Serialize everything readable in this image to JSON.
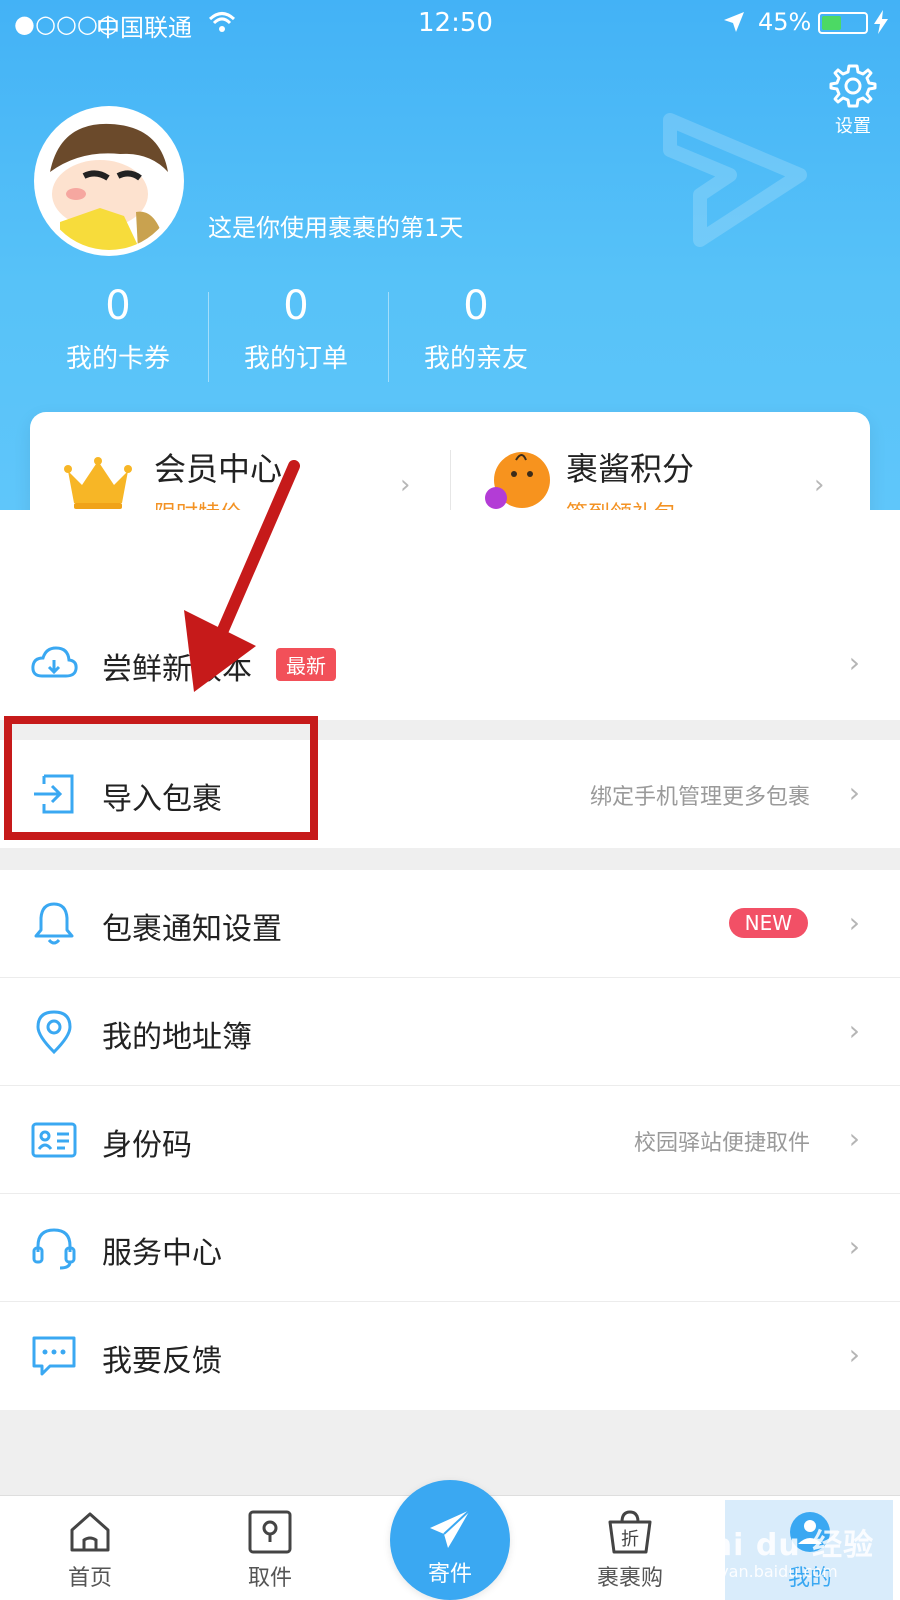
{
  "status_bar": {
    "signal": "●○○○○",
    "carrier": "中国联通",
    "time": "12:50",
    "battery_percent": "45%",
    "battery_level": 0.45
  },
  "header": {
    "settings_label": "设置",
    "welcome_text": "这是你使用裹裹的第1天",
    "stats": [
      {
        "value": "0",
        "label": "我的卡券"
      },
      {
        "value": "0",
        "label": "我的订单"
      },
      {
        "value": "0",
        "label": "我的亲友"
      }
    ]
  },
  "member_card": {
    "left": {
      "title": "会员中心",
      "subtitle": "限时特价",
      "icon": "crown-icon"
    },
    "right": {
      "title": "裹酱积分",
      "subtitle": "签到领礼包",
      "icon": "mascot-icon"
    }
  },
  "menu": {
    "beta": {
      "label": "尝鲜新版本",
      "badge": "最新",
      "icon": "cloud-download-icon"
    },
    "import": {
      "label": "导入包裹",
      "hint": "绑定手机管理更多包裹",
      "icon": "import-icon"
    },
    "notify": {
      "label": "包裹通知设置",
      "badge": "NEW",
      "icon": "bell-icon"
    },
    "address": {
      "label": "我的地址簿",
      "icon": "location-pin-icon"
    },
    "idcode": {
      "label": "身份码",
      "hint": "校园驿站便捷取件",
      "icon": "id-card-icon"
    },
    "service": {
      "label": "服务中心",
      "icon": "headset-icon"
    },
    "feedback": {
      "label": "我要反馈",
      "icon": "chat-bubble-icon"
    }
  },
  "tabbar": {
    "home": "首页",
    "pickup": "取件",
    "send": "寄件",
    "shop": "裹裹购",
    "shop_icon_text": "折",
    "mine": "我的"
  },
  "watermark": {
    "brand": "Bai du 经验",
    "url": "jingyan.baidu.com"
  },
  "colors": {
    "header_blue": "#4fbaf7",
    "accent_orange": "#f39223",
    "badge_red": "#f25059",
    "annotation_red": "#c61a1a",
    "icon_blue": "#3aa8f2"
  }
}
